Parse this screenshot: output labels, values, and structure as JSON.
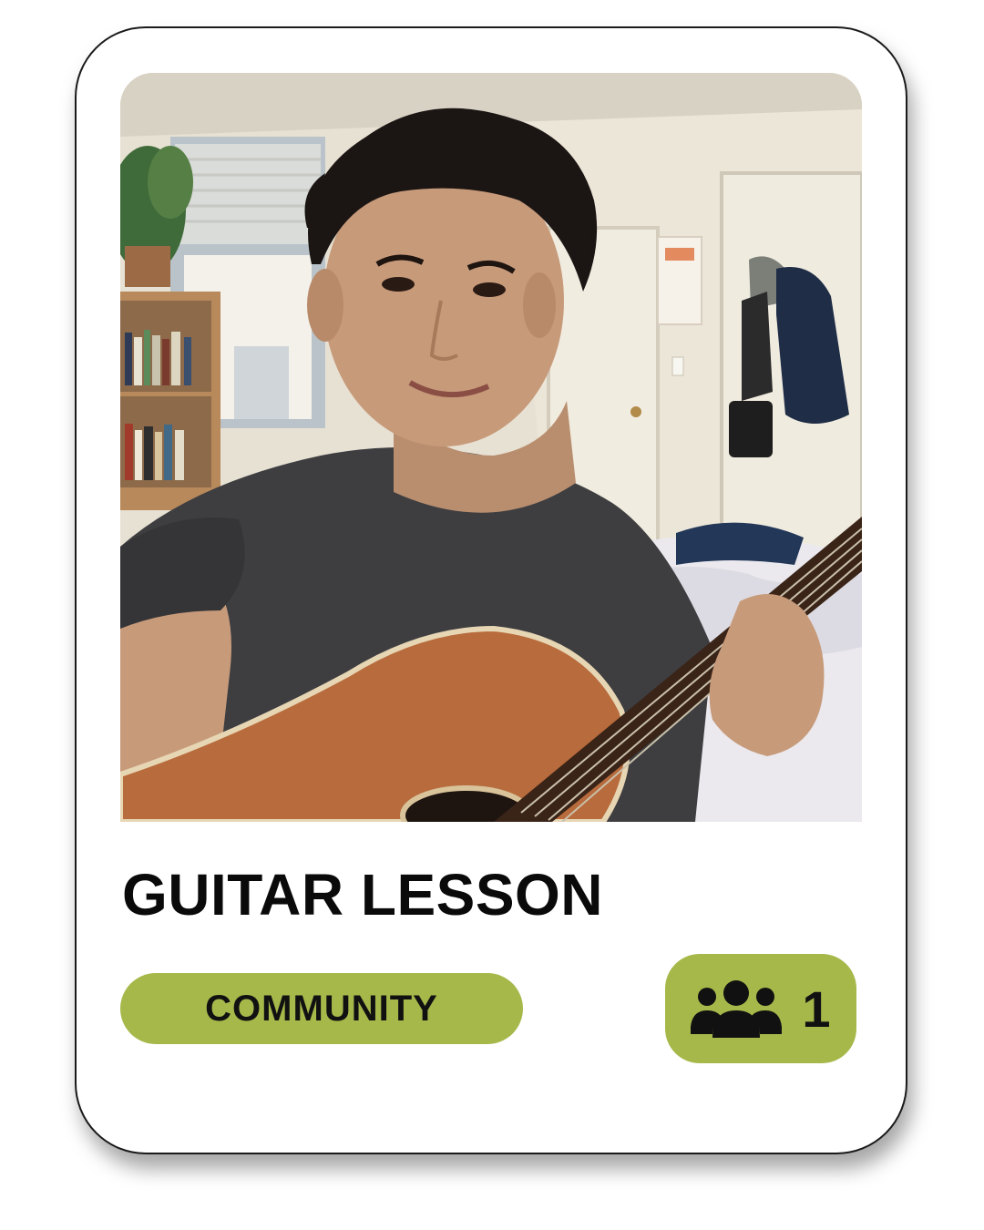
{
  "card": {
    "title": "GUITAR LESSON",
    "category": "COMMUNITY",
    "members": {
      "icon": "users-icon",
      "count": "1"
    },
    "photo": {
      "icon": "photo-of-man-playing-acoustic-guitar"
    }
  },
  "colors": {
    "accent": "#a7b84a",
    "text": "#0a0a0a",
    "card_border": "#1a1a1a"
  }
}
